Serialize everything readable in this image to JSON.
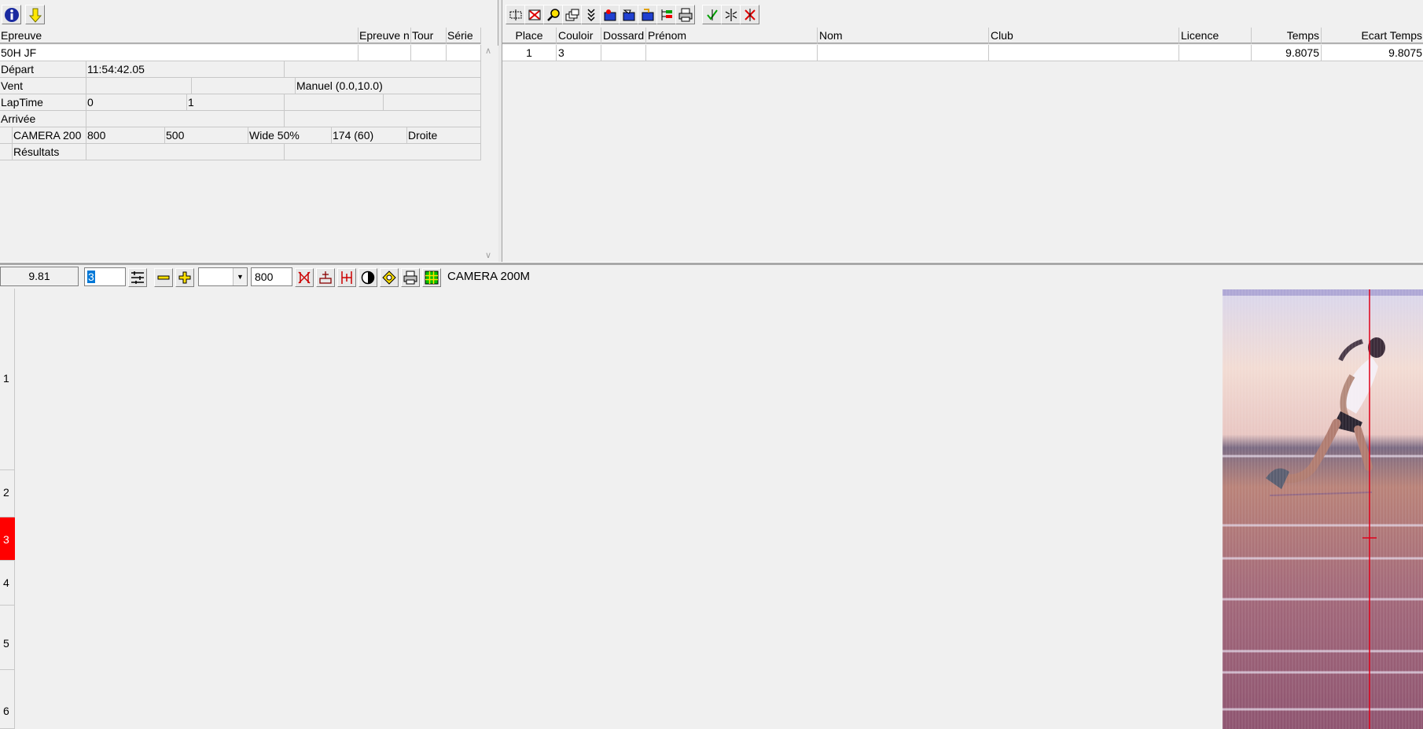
{
  "toolbar_left": {
    "buttons": [
      {
        "icon": "info-icon"
      },
      {
        "icon": "arrow-down-icon"
      }
    ]
  },
  "event_table": {
    "headers": [
      "Epreuve",
      "Epreuve n",
      "Tour",
      "Série"
    ],
    "event_name": "50H JF",
    "rows": [
      {
        "label": "Départ",
        "values": [
          "11:54:42.05",
          ""
        ]
      },
      {
        "label": "Vent",
        "values": [
          "",
          "",
          "Manuel (0.0,10.0)"
        ]
      },
      {
        "label": "LapTime",
        "values": [
          "0",
          "1",
          "",
          ""
        ]
      },
      {
        "label": "Arrivée",
        "values": [
          "",
          ""
        ]
      },
      {
        "label": "CAMERA 200",
        "values": [
          "800",
          "500",
          "Wide 50%",
          "174  (60)",
          "Droite"
        ]
      },
      {
        "label": "Résultats",
        "values": [
          "",
          ""
        ]
      }
    ]
  },
  "toolbar_right": {
    "buttons": [
      "select-all-icon",
      "delete-icon",
      "zoom-icon",
      "windows-icon",
      "expand-icon",
      "assign-icon",
      "edit-icon",
      "import-icon",
      "tree-icon",
      "print-icon",
      "accept-icon",
      "split-icon",
      "reject-icon"
    ]
  },
  "results_table": {
    "headers": [
      "Place",
      "Couloir",
      "Dossard",
      "Prénom",
      "Nom",
      "Club",
      "Licence",
      "Temps",
      "Ecart Temps"
    ],
    "rows": [
      {
        "place": "1",
        "couloir": "3",
        "dossard": "",
        "prenom": "",
        "nom": "",
        "club": "",
        "licence": "",
        "temps": "9.8075",
        "ecart": "9.8075"
      }
    ]
  },
  "viewer_toolbar": {
    "time": "9.81",
    "lane_value": "3",
    "zoom_select": "",
    "width_value": "800",
    "camera_label": "CAMERA 200M"
  },
  "lanes": [
    "1",
    "2",
    "3",
    "4",
    "5",
    "6"
  ],
  "active_lane": "3",
  "colors": {
    "active_lane": "#ff0000",
    "cursor_line": "#e0001a",
    "background": "#f0f0f0"
  }
}
